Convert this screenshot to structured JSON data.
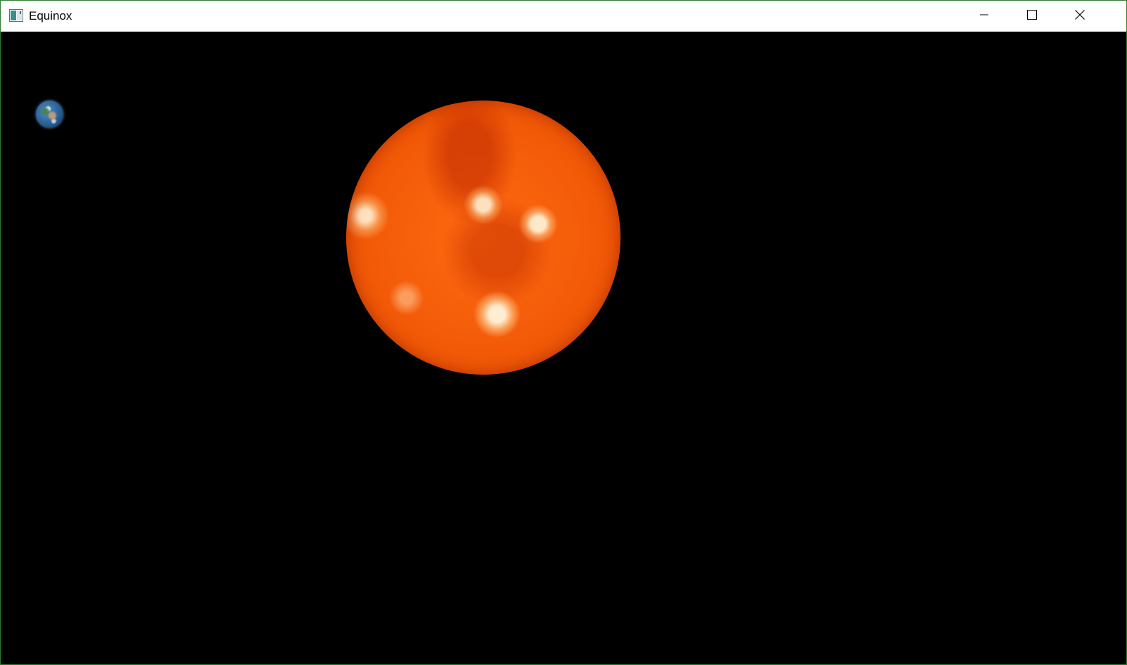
{
  "window": {
    "title": "Equinox",
    "accent_border_color": "#2f7d32"
  },
  "titlebar": {
    "app_icon": "app-window-icon",
    "controls": [
      {
        "name": "minimize",
        "icon": "minimize-icon"
      },
      {
        "name": "maximize",
        "icon": "maximize-icon"
      },
      {
        "name": "close",
        "icon": "close-icon"
      }
    ]
  },
  "scene": {
    "background_color": "#000000",
    "bodies": [
      {
        "name": "sun",
        "color": "#f25a08"
      },
      {
        "name": "earth",
        "color": "#2a5f94"
      }
    ]
  }
}
